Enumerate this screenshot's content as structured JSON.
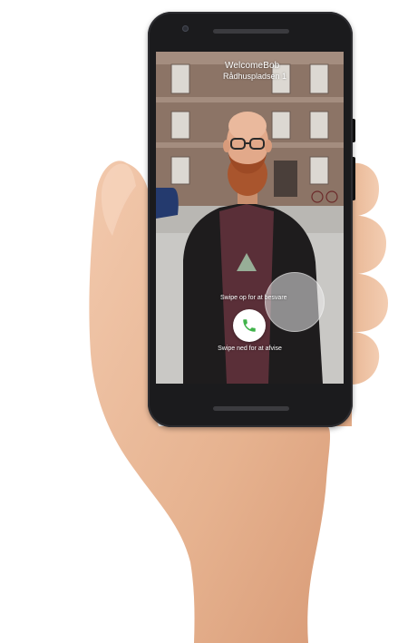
{
  "call": {
    "caller_name": "WelcomeBob",
    "caller_address": "Rådhuspladsen 1",
    "swipe_up_hint": "Swipe op for at besvare",
    "swipe_down_hint": "Swipe ned for at afvise"
  },
  "icons": {
    "answer": "phone-icon",
    "swipe_up": "arrow-up-icon",
    "unlock": "circle-icon"
  },
  "colors": {
    "answer_icon": "#3fb34a",
    "swipe_arrow": "#9bb59c",
    "phone_body": "#1b1b1d"
  }
}
